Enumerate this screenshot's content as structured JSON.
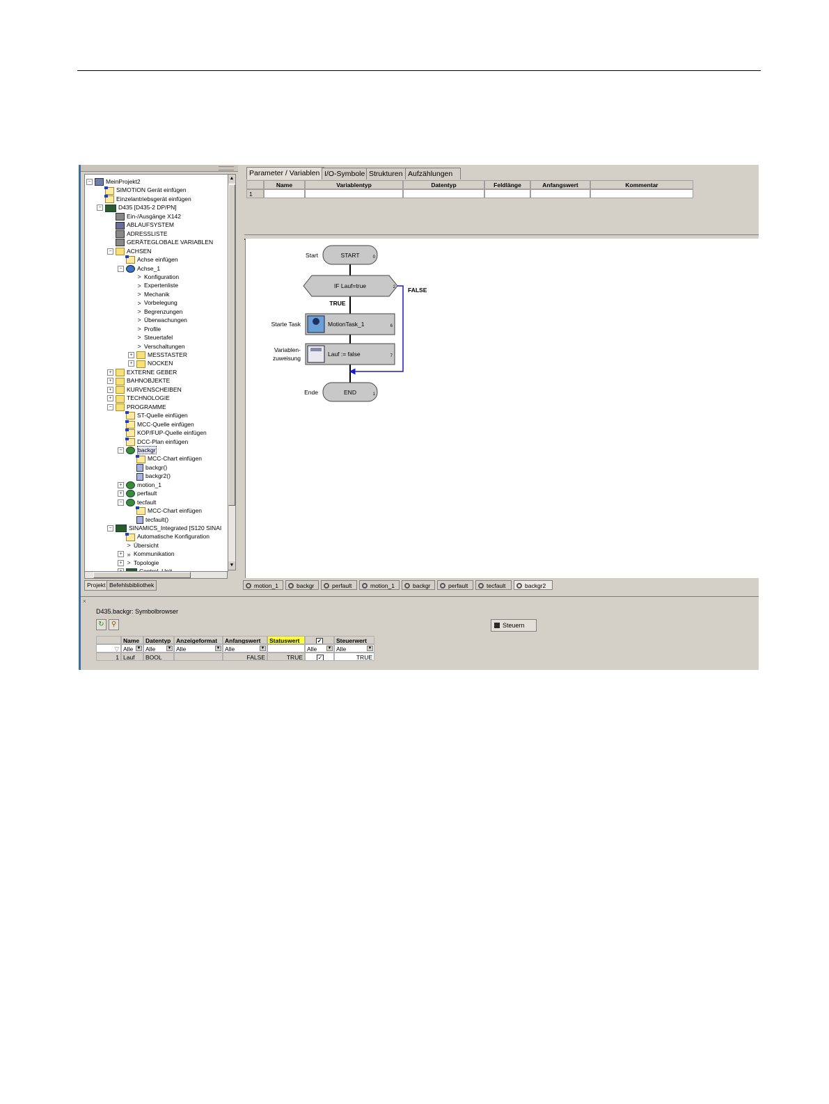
{
  "tree": {
    "items": [
      {
        "label": "MeinProjekt2",
        "icon": "project-icon"
      },
      {
        "label": "SIMOTION Gerät einfügen",
        "icon": "insert-icon"
      },
      {
        "label": "Einzelantriebsgerät einfügen",
        "icon": "insert-icon"
      },
      {
        "label": "D435 [D435-2 DP/PN]",
        "icon": "device-icon"
      },
      {
        "label": "Ein-/Ausgänge X142",
        "icon": "io-icon"
      },
      {
        "label": "ABLAUFSYSTEM",
        "icon": "system-icon"
      },
      {
        "label": "ADRESSLISTE",
        "icon": "address-icon"
      },
      {
        "label": "GERÄTEGLOBALE VARIABLEN",
        "icon": "variables-icon"
      },
      {
        "label": "ACHSEN",
        "icon": "folder-icon"
      },
      {
        "label": "Achse einfügen",
        "icon": "insert-icon"
      },
      {
        "label": "Achse_1",
        "icon": "axis-icon"
      },
      {
        "label": "Konfiguration",
        "icon": "chevron-right-icon"
      },
      {
        "label": "Expertenliste",
        "icon": "chevron-right-icon"
      },
      {
        "label": "Mechanik",
        "icon": "chevron-right-icon"
      },
      {
        "label": "Vorbelegung",
        "icon": "chevron-right-icon"
      },
      {
        "label": "Begrenzungen",
        "icon": "chevron-right-icon"
      },
      {
        "label": "Überwachungen",
        "icon": "chevron-right-icon"
      },
      {
        "label": "Profile",
        "icon": "chevron-right-icon"
      },
      {
        "label": "Steuertafel",
        "icon": "chevron-right-icon"
      },
      {
        "label": "Verschaltungen",
        "icon": "chevron-right-icon"
      },
      {
        "label": "MESSTASTER",
        "icon": "folder-icon"
      },
      {
        "label": "NOCKEN",
        "icon": "folder-icon"
      },
      {
        "label": "EXTERNE GEBER",
        "icon": "folder-icon"
      },
      {
        "label": "BAHNOBJEKTE",
        "icon": "folder-icon"
      },
      {
        "label": "KURVENSCHEIBEN",
        "icon": "folder-icon"
      },
      {
        "label": "TECHNOLOGIE",
        "icon": "folder-icon"
      },
      {
        "label": "PROGRAMME",
        "icon": "folder-icon"
      },
      {
        "label": "ST-Quelle einfügen",
        "icon": "insert-icon"
      },
      {
        "label": "MCC-Quelle einfügen",
        "icon": "insert-icon"
      },
      {
        "label": "KOP/FUP-Quelle einfügen",
        "icon": "insert-icon"
      },
      {
        "label": "DCC-Plan einfügen",
        "icon": "insert-icon"
      },
      {
        "label": "backgr",
        "icon": "program-unit-icon"
      },
      {
        "label": "MCC-Chart einfügen",
        "icon": "insert-icon"
      },
      {
        "label": "backgr()",
        "icon": "program-icon"
      },
      {
        "label": "backgr2()",
        "icon": "program-icon"
      },
      {
        "label": "motion_1",
        "icon": "program-unit-icon"
      },
      {
        "label": "perfault",
        "icon": "program-unit-icon"
      },
      {
        "label": "tecfault",
        "icon": "program-unit-icon"
      },
      {
        "label": "MCC-Chart einfügen",
        "icon": "insert-icon"
      },
      {
        "label": "tecfault()",
        "icon": "program-icon"
      },
      {
        "label": "SINAMICS_Integrated [S120 SINAI",
        "icon": "device-icon"
      },
      {
        "label": "Automatische Konfiguration",
        "icon": "insert-icon"
      },
      {
        "label": "Übersicht",
        "icon": "chevron-right-icon"
      },
      {
        "label": "Kommunikation",
        "icon": "double-chevron-icon"
      },
      {
        "label": "Topologie",
        "icon": "chevron-right-icon"
      },
      {
        "label": "Control_Unit",
        "icon": "device-icon"
      }
    ],
    "tabs": [
      "Projekt",
      "Befehlsbibliothek"
    ]
  },
  "params": {
    "tabs": [
      "Parameter / Variablen",
      "I/O-Symbole",
      "Strukturen",
      "Aufzählungen"
    ],
    "columns": [
      "Name",
      "Variablentyp",
      "Datentyp",
      "Feldlänge",
      "Anfangswert",
      "Kommentar"
    ],
    "row_index": "1"
  },
  "flow": {
    "start": {
      "side": "Start",
      "text": "START",
      "num": "0"
    },
    "if": {
      "text": "IF Lauf=true",
      "num": "2",
      "true_label": "TRUE",
      "false_label": "FALSE"
    },
    "task": {
      "side": "Starte Task",
      "text": "MotionTask_1",
      "num": "6"
    },
    "assign": {
      "side_line1": "Variablen-",
      "side_line2": "zuweisung",
      "text": "Lauf := false",
      "num": "7"
    },
    "end": {
      "side": "Ende",
      "text": "END",
      "num": "1"
    },
    "colors": {
      "node_fill": "#c8c8c8",
      "branch_line": "#1a1acc"
    }
  },
  "editor_tabs": [
    "motion_1",
    "backgr",
    "perfault",
    "motion_1",
    "backgr",
    "perfault",
    "tecfault",
    "backgr2"
  ],
  "symbol_browser": {
    "title": "D435.backgr: Symbolbrowser",
    "steuern_label": "Steuern",
    "headers": [
      "Name",
      "Datentyp",
      "Anzeigeformat",
      "Anfangswert",
      "Statuswert",
      "",
      "Steuerwert"
    ],
    "filter": [
      "Alle",
      "Alle",
      "Alle",
      "Alle",
      "Alle",
      "Alle"
    ],
    "row": {
      "index": "1",
      "name": "Lauf",
      "type": "BOOL",
      "format": "",
      "initial": "FALSE",
      "status": "TRUE",
      "control": "TRUE"
    }
  }
}
